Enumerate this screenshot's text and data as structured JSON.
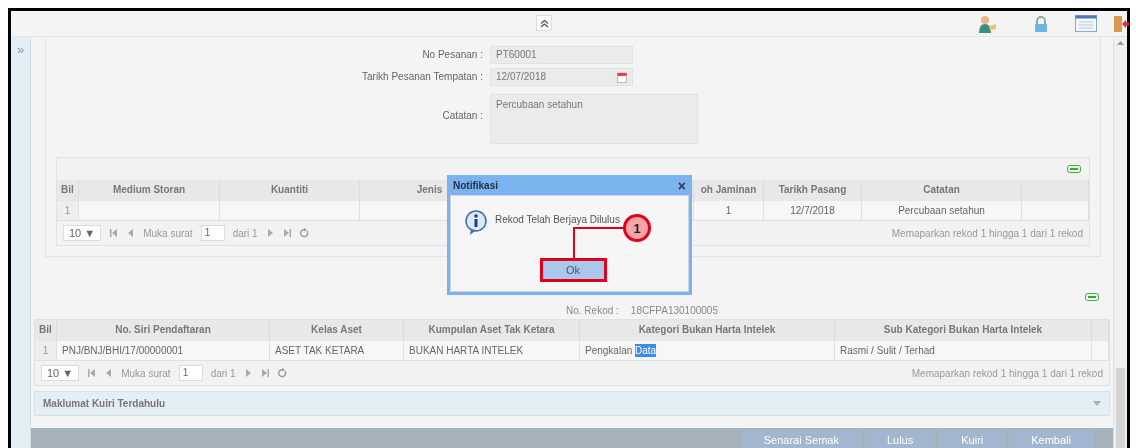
{
  "sidebar_toggle": "»",
  "form": {
    "fields": [
      {
        "label": "No Pesanan :",
        "value": "PT60001",
        "kind": "text"
      },
      {
        "label": "Tarikh Pesanan Tempatan :",
        "value": "12/07/2018",
        "kind": "date"
      },
      {
        "label": "Catatan :",
        "value": "Percubaan setahun",
        "kind": "textarea"
      }
    ]
  },
  "storage_table": {
    "columns": [
      {
        "header": "Bil"
      },
      {
        "header": "Medium Storan"
      },
      {
        "header": "Kuantiti"
      },
      {
        "header": "Jenis"
      },
      null,
      {
        "header": "oh Jaminan"
      },
      {
        "header": "Tarikh Pasang"
      },
      {
        "header": "Catatan"
      },
      null
    ],
    "rows": [
      [
        "1",
        null,
        null,
        null,
        null,
        "1",
        "12/7/2018",
        "Percubaan setahun",
        null
      ]
    ],
    "pager": {
      "page_size": "10 ▼",
      "page_label": "Muka surat",
      "page": "1",
      "page_total": "dari 1",
      "summary": "Memaparkan rekod 1 hingga 1 dari 1 rekod"
    }
  },
  "record": {
    "label": "No. Rekod :",
    "value": "18CFPA130100005"
  },
  "asset_table": {
    "columns": [
      {
        "header": "Bil"
      },
      {
        "header": "No. Siri Pendaftaran"
      },
      {
        "header": "Kelas Aset"
      },
      {
        "header": "Kumpulan Aset Tak Ketara"
      },
      {
        "header": "Kategori Bukan Harta Intelek"
      },
      {
        "header": "Sub Kategori Bukan Harta Intelek"
      },
      null
    ],
    "rows": [
      [
        {
          "text": "1"
        },
        {
          "text": "PNJ/BNJ/BHI/17/00000001"
        },
        {
          "text": "ASET TAK KETARA"
        },
        {
          "text": "BUKAN HARTA INTELEK"
        },
        {
          "text": "Pengkalan",
          "highlighted": "Data"
        },
        {
          "text": "Rasmi / Sulit / Terhad"
        },
        {
          "text": null
        }
      ]
    ],
    "pager": {
      "page_size": "10 ▼",
      "page_label": "Muka surat",
      "page": "1",
      "page_total": "dari 1",
      "summary": "Memaparkan rekod 1 hingga 1 dari 1 rekod"
    }
  },
  "collapsible": {
    "title": "Maklumat Kuiri Terdahulu",
    "expanded": false
  },
  "footer_buttons": [
    "Senarai Semak",
    "Lulus",
    "Kuiri",
    "Kembali"
  ],
  "dialog": {
    "title": "Notifikasi",
    "close": "×",
    "message": "Rekod Telah Berjaya Dilulus",
    "button": "Ok",
    "callout": "1"
  }
}
